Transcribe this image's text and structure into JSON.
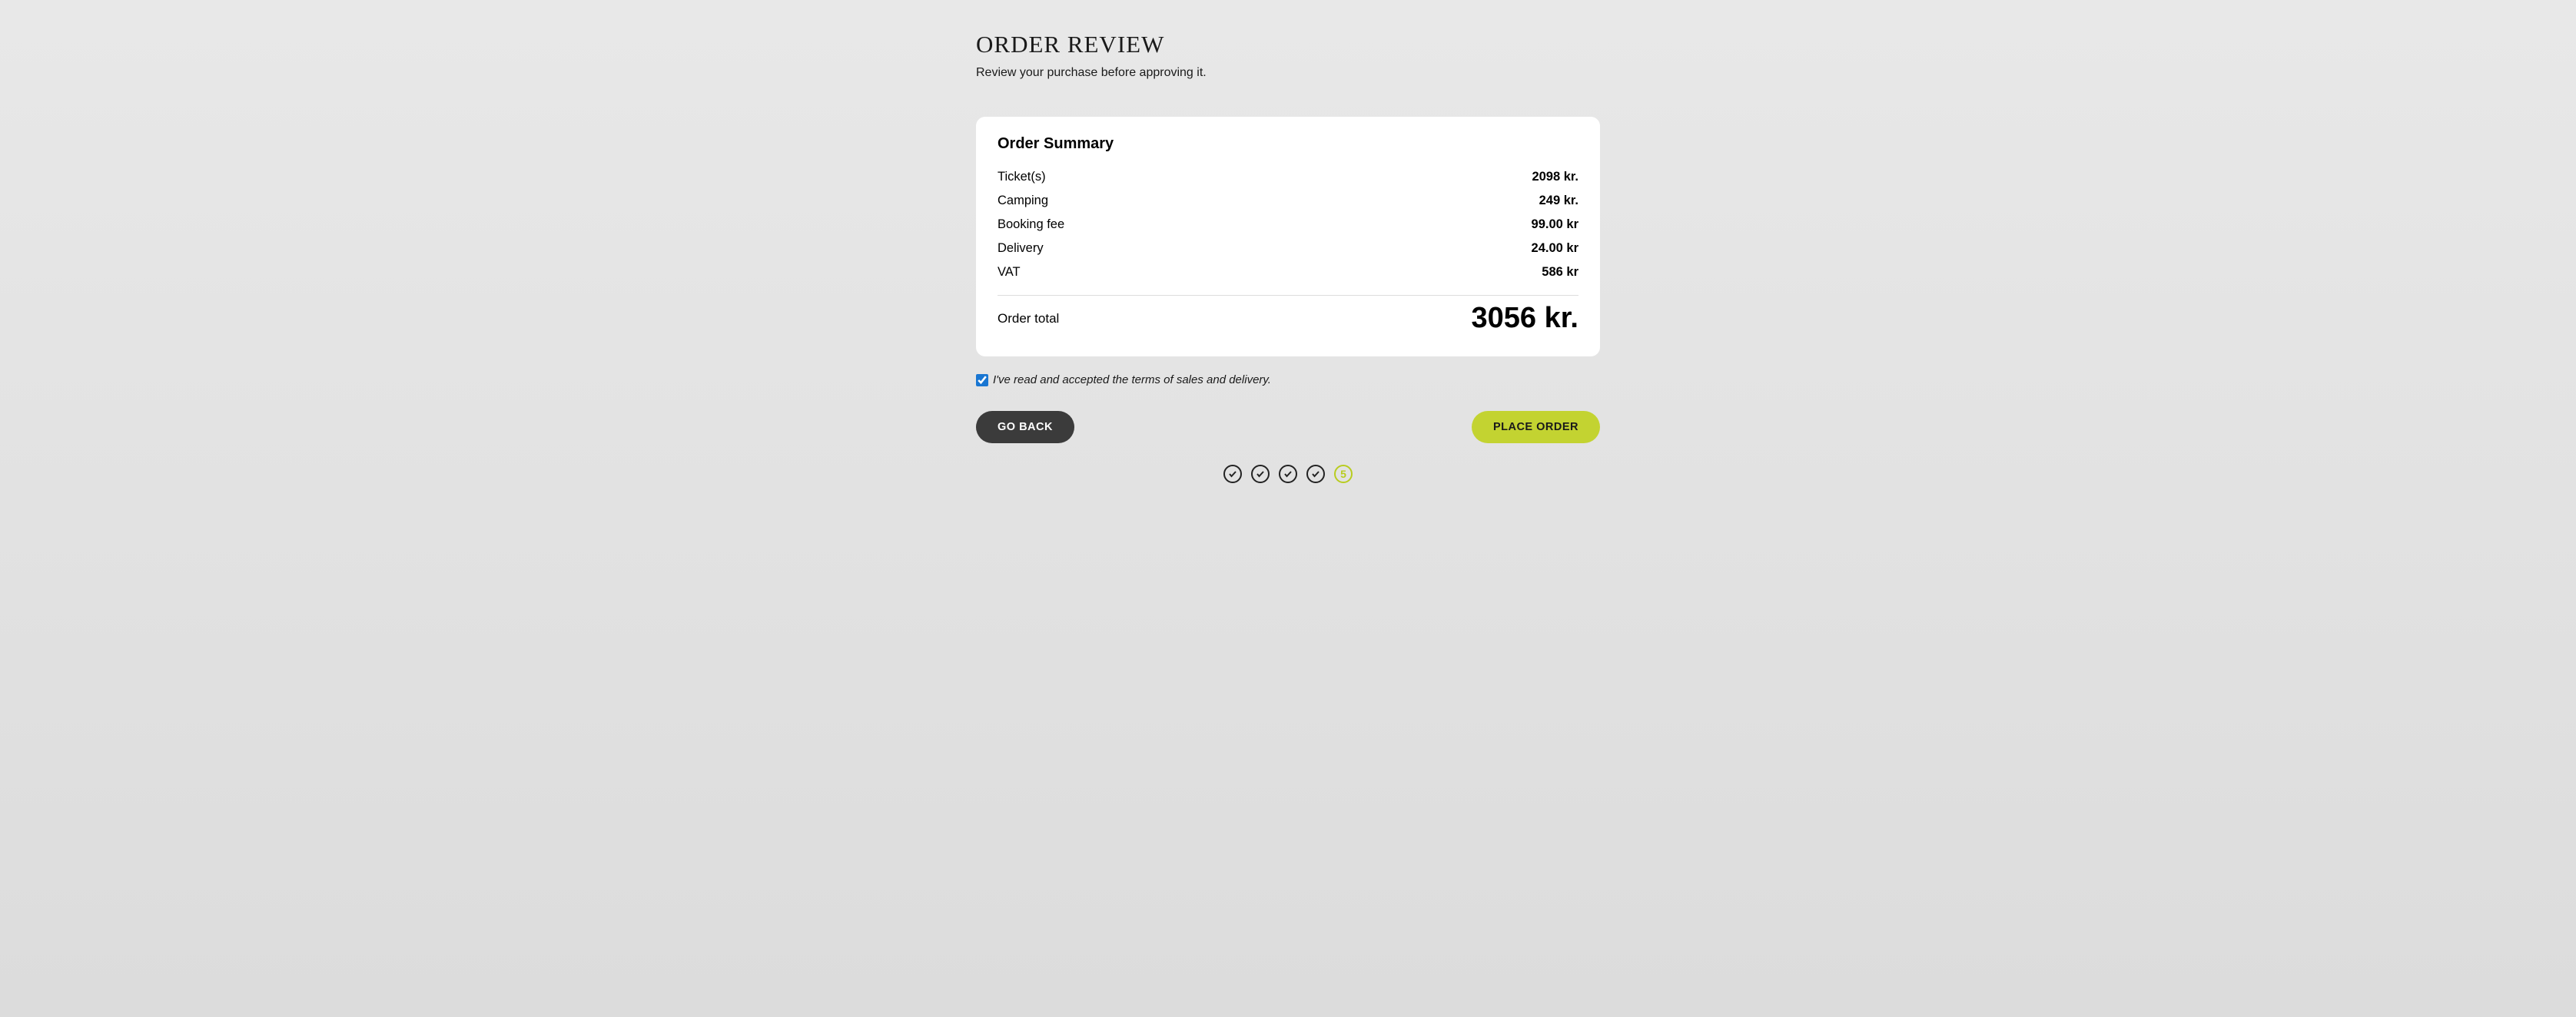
{
  "page": {
    "title": "ORDER REVIEW",
    "subtitle": "Review your purchase before approving it."
  },
  "summary": {
    "title": "Order Summary",
    "rows": [
      {
        "label": "Ticket(s)",
        "value": "2098 kr."
      },
      {
        "label": "Camping",
        "value": "249 kr."
      },
      {
        "label": "Booking fee",
        "value": "99.00 kr"
      },
      {
        "label": "Delivery",
        "value": "24.00 kr"
      },
      {
        "label": "VAT",
        "value": "586 kr"
      }
    ],
    "total_label": "Order total",
    "total_value": "3056 kr."
  },
  "terms": {
    "checked": true,
    "label": "I've read and accepted the terms of sales and delivery."
  },
  "buttons": {
    "back": "GO BACK",
    "place": "PLACE ORDER"
  },
  "stepper": {
    "completed_steps": 4,
    "current_step": "5"
  }
}
